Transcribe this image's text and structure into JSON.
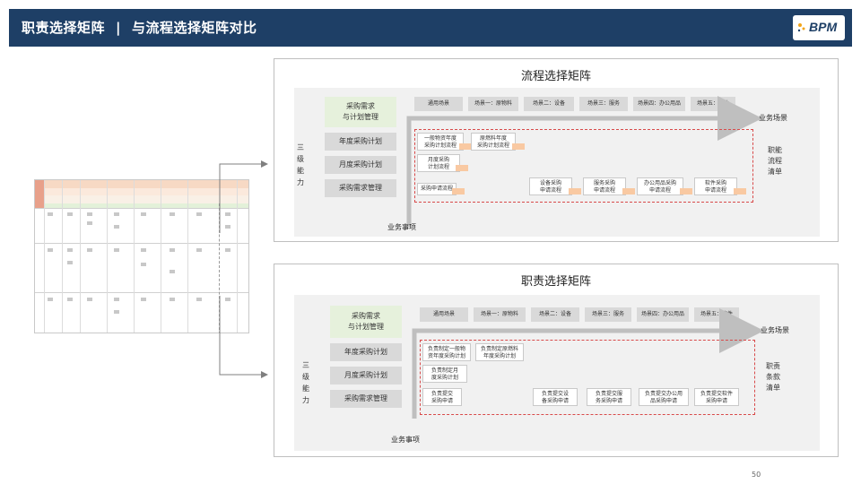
{
  "header": {
    "title_left": "职责选择矩阵",
    "separator": "|",
    "title_right": "与流程选择矩阵对比",
    "logo_text": "BPM",
    "bg_color": "#1e3f66"
  },
  "panel1": {
    "title": "流程选择矩阵",
    "top_box": "采购需求\n与计划管理",
    "left_boxes": [
      "年度采购计划",
      "月度采购计划",
      "采购需求管理"
    ],
    "side_label": "三\n级\n能\n力",
    "scenes": [
      "通用场景",
      "场景一：原物料",
      "场景二：设备",
      "场景三：服务",
      "场景四：办公用品",
      "场景五：软件"
    ],
    "axis_x": "业务场景",
    "axis_y": "业务事项",
    "right_label": "职能\n流程\n清单",
    "items": [
      "一般物资年度\n采购计划流程",
      "原燃料年度\n采购计划流程",
      "月度采购\n计划流程",
      "采购申请流程",
      "设备采购\n申请流程",
      "服务采购\n申请流程",
      "办公用品采购\n申请流程",
      "软件采购\n申请流程"
    ]
  },
  "panel2": {
    "title": "职责选择矩阵",
    "top_box": "采购需求\n与计划管理",
    "left_boxes": [
      "年度采购计划",
      "月度采购计划",
      "采购需求管理"
    ],
    "side_label": "三\n级\n能\n力",
    "scenes": [
      "通用场景",
      "场景一：原物料",
      "场景二：设备",
      "场景三：服务",
      "场景四：办公用品",
      "场景五：软件"
    ],
    "axis_x": "业务场景",
    "axis_y": "业务事项",
    "right_label": "职责\n条款\n清单",
    "items": [
      "负责制定一般物\n资年度采购计划",
      "负责制定原燃料\n年度采购计划",
      "负责制定月\n度采购计划",
      "负责提交\n采购申请",
      "负责提交设\n备采购申请",
      "负责提交服\n务采购申请",
      "负责提交办公用\n品采购申请",
      "负责提交软件\n采购申请"
    ]
  },
  "page_number": "50",
  "colors": {
    "accent_red": "#d84a4a",
    "green_box": "#e6f1dc",
    "grey_box": "#d9d9d9",
    "tag_orange": "#f9c9a2"
  }
}
